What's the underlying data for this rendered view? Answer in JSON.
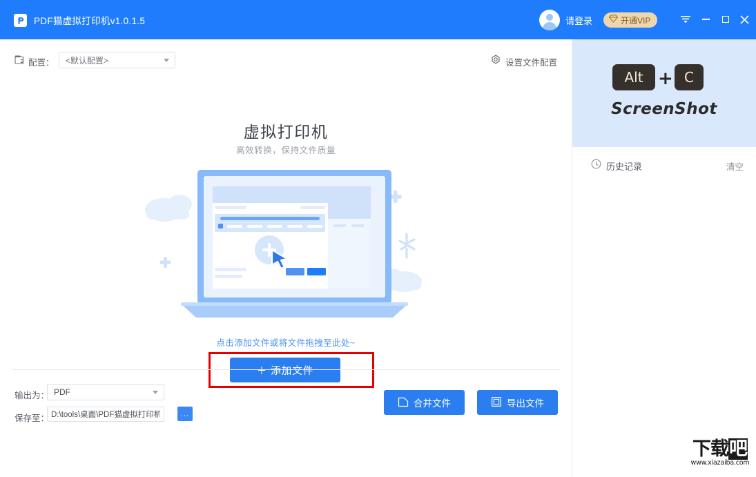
{
  "titlebar": {
    "app_title": "PDF猫虚拟打印机v1.0.1.5",
    "logo_icon": "pdf-cat-logo-icon",
    "avatar_icon": "user-avatar-icon",
    "login_label": "请登录",
    "vip_label": "开通VIP",
    "vip_icon": "diamond-icon",
    "menu_icon": "menu-icon",
    "minimize_icon": "minimize-icon",
    "maximize_icon": "maximize-icon",
    "close_icon": "close-icon",
    "bar_color": "#1f7dfd",
    "vip_pill_color": "#efd7ad"
  },
  "toolbar": {
    "config_icon": "config-file-icon",
    "config_label": "配置：",
    "config_value": "<默认配置>",
    "file_config_icon": "gear-icon",
    "file_config_label": "设置文件配置"
  },
  "hero": {
    "title": "虚拟打印机",
    "subtitle": "高效转换，保持文件质量",
    "illustration": "laptop-upload-illustration",
    "drop_hint": "点击添加文件或将文件拖拽至此处~",
    "add_button_label": "＋ 添加文件",
    "add_button_color": "#2b7ef0",
    "highlight_color": "#e60000"
  },
  "footer": {
    "output_label": "输出为：",
    "output_value": "PDF",
    "save_label": "保存至：",
    "save_path": "D:\\tools\\桌面\\PDF猫虚拟打印机",
    "browse_label": "...",
    "merge_label": "合并文件",
    "merge_icon": "merge-document-icon",
    "export_label": "导出文件",
    "export_icon": "export-document-icon"
  },
  "right_panel": {
    "banner": {
      "key_alt": "Alt",
      "key_plus": "+",
      "key_c": "C",
      "word": "ScreenShot",
      "bg_color": "#d9e9fb"
    },
    "history": {
      "clock_icon": "clock-icon",
      "label": "历史记录",
      "clear_label": "清空"
    }
  },
  "watermark": {
    "text_1": "下",
    "text_2": "载",
    "text_3": "吧",
    "url": "www.xiazaiba.com"
  }
}
